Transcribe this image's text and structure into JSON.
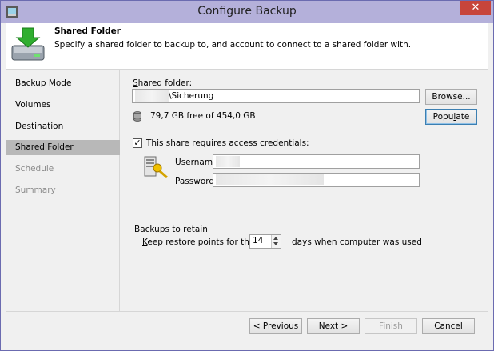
{
  "window": {
    "title": "Configure Backup",
    "close_label": "✕"
  },
  "header": {
    "title": "Shared Folder",
    "description": "Specify a shared folder to backup to, and account to connect to a shared folder with."
  },
  "sidebar": {
    "items": [
      {
        "label": "Backup Mode",
        "state": "normal"
      },
      {
        "label": "Volumes",
        "state": "normal"
      },
      {
        "label": "Destination",
        "state": "normal"
      },
      {
        "label": "Shared Folder",
        "state": "active"
      },
      {
        "label": "Schedule",
        "state": "disabled"
      },
      {
        "label": "Summary",
        "state": "disabled"
      }
    ]
  },
  "shared_folder": {
    "label_prefix": "S",
    "label_rest": "hared folder:",
    "path_value": "\\Sicherung",
    "browse_label": "Browse...",
    "free_space": "79,7 GB free of 454,0 GB",
    "populate_prefix": "Popu",
    "populate_underline": "l",
    "populate_rest": "ate"
  },
  "credentials": {
    "checkbox_label": "This share requires access credentials:",
    "checked": true,
    "check_mark": "✓",
    "username_prefix": "U",
    "username_rest": "sername:",
    "password_label": "Password:"
  },
  "retention": {
    "group_label": "Backups to retain",
    "keep_prefix": "K",
    "keep_rest": "eep restore points for the last",
    "days_value": "14",
    "days_suffix": "days when computer was used"
  },
  "footer": {
    "previous_label": "< Previous",
    "next_label": "Next >",
    "finish_label": "Finish",
    "cancel_label": "Cancel"
  },
  "colors": {
    "titlebar": "#b4b0da",
    "close_button": "#c7453b",
    "active_nav": "#b8b8b8"
  }
}
